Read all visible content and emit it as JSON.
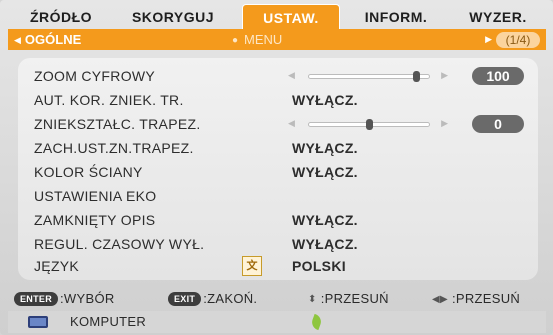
{
  "tabs": [
    {
      "label": "ŹRÓDŁO"
    },
    {
      "label": "SKORYGUJ"
    },
    {
      "label": "USTAW."
    },
    {
      "label": "INFORM."
    },
    {
      "label": "WYZER."
    }
  ],
  "subheader": {
    "left_label": "OGÓLNE",
    "center_label": "MENU",
    "page_indicator": "1/4"
  },
  "settings": [
    {
      "label": "ZOOM CYFROWY",
      "pill": "100",
      "slider_fraction": 0.86
    },
    {
      "label": "AUT. KOR. ZNIEK. TR.",
      "value": "WYŁĄCZ."
    },
    {
      "label": "ZNIEKSZTAŁC. TRAPEZ.",
      "pill": "0",
      "slider_fraction": 0.5
    },
    {
      "label": "ZACH.UST.ZN.TRAPEZ.",
      "value": "WYŁĄCZ."
    },
    {
      "label": "KOLOR ŚCIANY",
      "value": "WYŁĄCZ."
    },
    {
      "label": "USTAWIENIA EKO",
      "value": ""
    },
    {
      "label": "ZAMKNIĘTY OPIS",
      "value": "WYŁĄCZ."
    },
    {
      "label": "REGUL. CZASOWY WYŁ.",
      "value": "WYŁĄCZ."
    },
    {
      "label": "JĘZYK",
      "value": "POLSKI"
    }
  ],
  "footer_keys": {
    "enter_badge": "ENTER",
    "enter_label": ":WYBÓR",
    "exit_badge": "EXIT",
    "exit_label": ":ZAKOŃ.",
    "updown_label": ":PRZESUŃ",
    "leftright_label": ":PRZESUŃ"
  },
  "source_bar": {
    "label": "KOMPUTER"
  },
  "colors": {
    "accent": "#f49a1c",
    "panel": "#eaeaea",
    "pill": "#6a6a6a"
  }
}
